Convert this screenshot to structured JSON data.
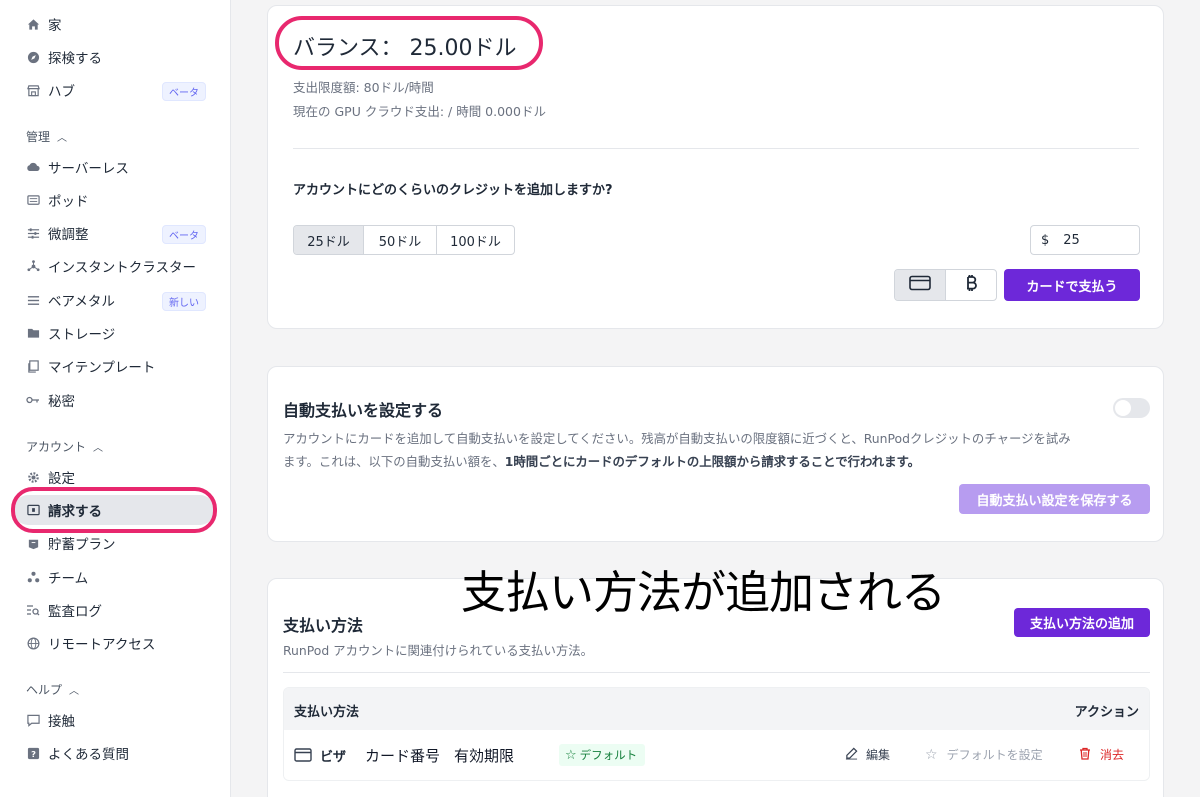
{
  "sidebar": {
    "top": [
      {
        "label": "家",
        "icon": "home-icon"
      },
      {
        "label": "探検する",
        "icon": "compass-icon"
      },
      {
        "label": "ハブ",
        "icon": "store-icon",
        "badge": "ベータ"
      }
    ],
    "manage_label": "管理",
    "manage": [
      {
        "label": "サーバーレス",
        "icon": "cloud-icon"
      },
      {
        "label": "ポッド",
        "icon": "server-icon"
      },
      {
        "label": "微調整",
        "icon": "sliders-icon",
        "badge": "ベータ"
      },
      {
        "label": "インスタントクラスター",
        "icon": "cluster-icon"
      },
      {
        "label": "ベアメタル",
        "icon": "list-icon",
        "badge": "新しい"
      },
      {
        "label": "ストレージ",
        "icon": "folder-icon"
      },
      {
        "label": "マイテンプレート",
        "icon": "template-icon"
      },
      {
        "label": "秘密",
        "icon": "key-icon"
      }
    ],
    "account_label": "アカウント",
    "account": [
      {
        "label": "設定",
        "icon": "gear-icon"
      },
      {
        "label": "請求する",
        "icon": "billing-icon"
      },
      {
        "label": "貯蓄プラン",
        "icon": "piggy-bank-icon"
      },
      {
        "label": "チーム",
        "icon": "team-icon"
      },
      {
        "label": "監査ログ",
        "icon": "audit-icon"
      },
      {
        "label": "リモートアクセス",
        "icon": "globe-icon"
      }
    ],
    "help_label": "ヘルプ",
    "help": [
      {
        "label": "接触",
        "icon": "chat-icon"
      },
      {
        "label": "よくある質問",
        "icon": "question-icon"
      }
    ]
  },
  "balance": {
    "title": "バランス： 25.00ドル",
    "limit": "支出限度額: 80ドル/時間",
    "gpu_spend": "現在の GPU クラウド支出: / 時間 0.000ドル",
    "question": "アカウントにどのくらいのクレジットを追加しますか?",
    "amounts": [
      "25ドル",
      "50ドル",
      "100ドル"
    ],
    "currency_symbol": "$",
    "amount_value": "25",
    "pay_button": "カードで支払う"
  },
  "autopay": {
    "title": "自動支払いを設定する",
    "desc_1": "アカウントにカードを追加して自動支払いを設定してください。残高が自動支払いの限度額に近づくと、RunPodクレジットのチャージを試み",
    "desc_2": "ます。これは、以下の自動支払い額を、",
    "desc_bold": "1時間ごとにカードのデフォルトの上限額から請求することで行われます。",
    "save_button": "自動支払い設定を保存する"
  },
  "annotation": "支払い方法が追加される",
  "payment_methods": {
    "title": "支払い方法",
    "add_button": "支払い方法の追加",
    "subtitle": "RunPod アカウントに関連付けられている支払い方法。",
    "col_method": "支払い方法",
    "col_action": "アクション",
    "row": {
      "brand": "ビザ",
      "card_number": "カード番号",
      "expiry": "有効期限",
      "default_badge": "デフォルト",
      "edit": "編集",
      "set_default": "デフォルトを設定",
      "delete": "消去"
    }
  },
  "colors": {
    "accent": "#6d28d9",
    "highlight": "#e8286e",
    "default_badge": "#15803d",
    "delete": "#dc2626"
  }
}
